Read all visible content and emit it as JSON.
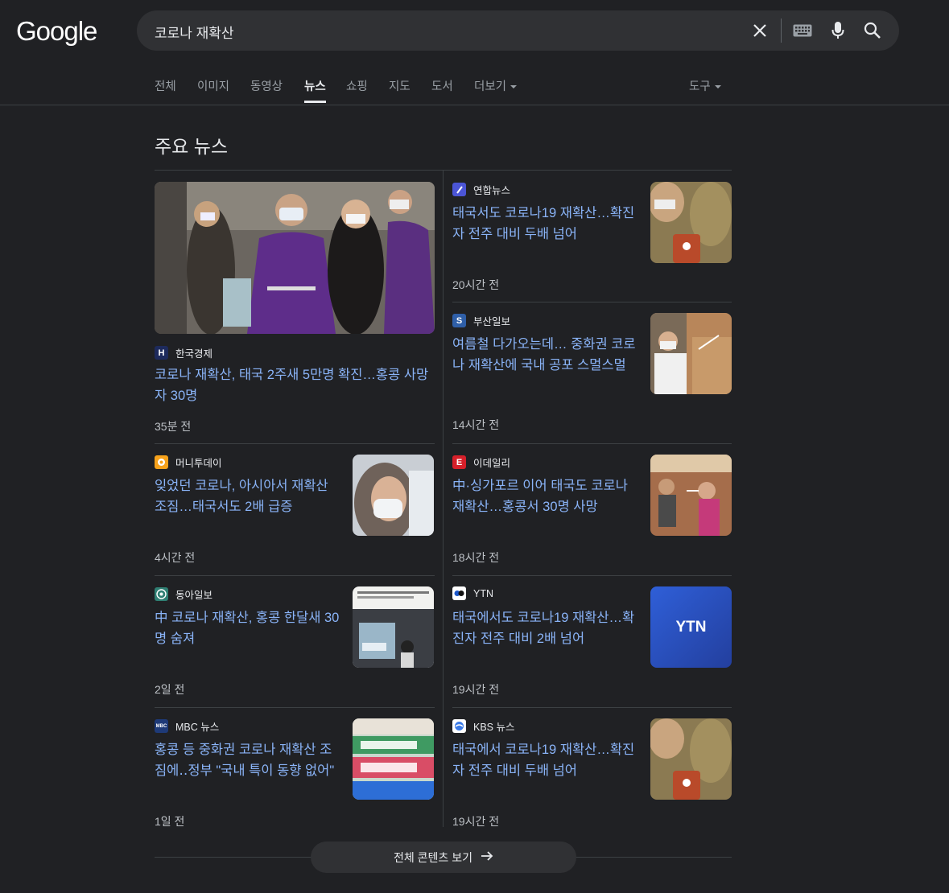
{
  "logo": "Google",
  "search": {
    "query": "코로나 재확산"
  },
  "tabs": [
    {
      "label": "전체"
    },
    {
      "label": "이미지"
    },
    {
      "label": "동영상"
    },
    {
      "label": "뉴스"
    },
    {
      "label": "쇼핑"
    },
    {
      "label": "지도"
    },
    {
      "label": "도서"
    },
    {
      "label": "더보기"
    }
  ],
  "tools_label": "도구",
  "section_title": "주요 뉴스",
  "featured": {
    "source": "한국경제",
    "headline": "코로나 재확산, 태국 2주새 5만명 확진…홍콩 사망자 30명",
    "time": "35분 전"
  },
  "left_articles": [
    {
      "source": "머니투데이",
      "headline": "잊었던 코로나, 아시아서 재확산 조짐…태국서도 2배 급증",
      "time": "4시간 전"
    },
    {
      "source": "동아일보",
      "headline": "中 코로나 재확산, 홍콩 한달새 30명 숨져",
      "time": "2일 전"
    },
    {
      "source": "MBC 뉴스",
      "headline": "홍콩 등 중화권 코로나 재확산 조짐에‥정부 \"국내 특이 동향 없어\"",
      "time": "1일 전"
    }
  ],
  "right_articles": [
    {
      "source": "연합뉴스",
      "headline": "태국서도 코로나19 재확산…확진자 전주 대비 두배 넘어",
      "time": "20시간 전"
    },
    {
      "source": "부산일보",
      "headline": "여름철 다가오는데… 중화권 코로나 재확산에 국내 공포 스멀스멀",
      "time": "14시간 전"
    },
    {
      "source": "이데일리",
      "headline": "中·싱가포르 이어 태국도 코로나 재확산…홍콩서 30명 사망",
      "time": "18시간 전"
    },
    {
      "source": "YTN",
      "headline": "태국에서도 코로나19 재확산…확진자 전주 대비 2배 넘어",
      "time": "19시간 전"
    },
    {
      "source": "KBS 뉴스",
      "headline": "태국에서 코로나19 재확산…확진자 전주 대비 두배 넘어",
      "time": "19시간 전"
    }
  ],
  "thumb_text": {
    "ytn": "YTN"
  },
  "favicons": {
    "hankyung": "H",
    "busan": "S",
    "edaily": "E",
    "mbc": "MBC"
  },
  "more_label": "전체 콘텐츠 보기",
  "colors": {
    "background": "#202124",
    "link": "#8ab4f8",
    "searchbar": "#303134"
  }
}
